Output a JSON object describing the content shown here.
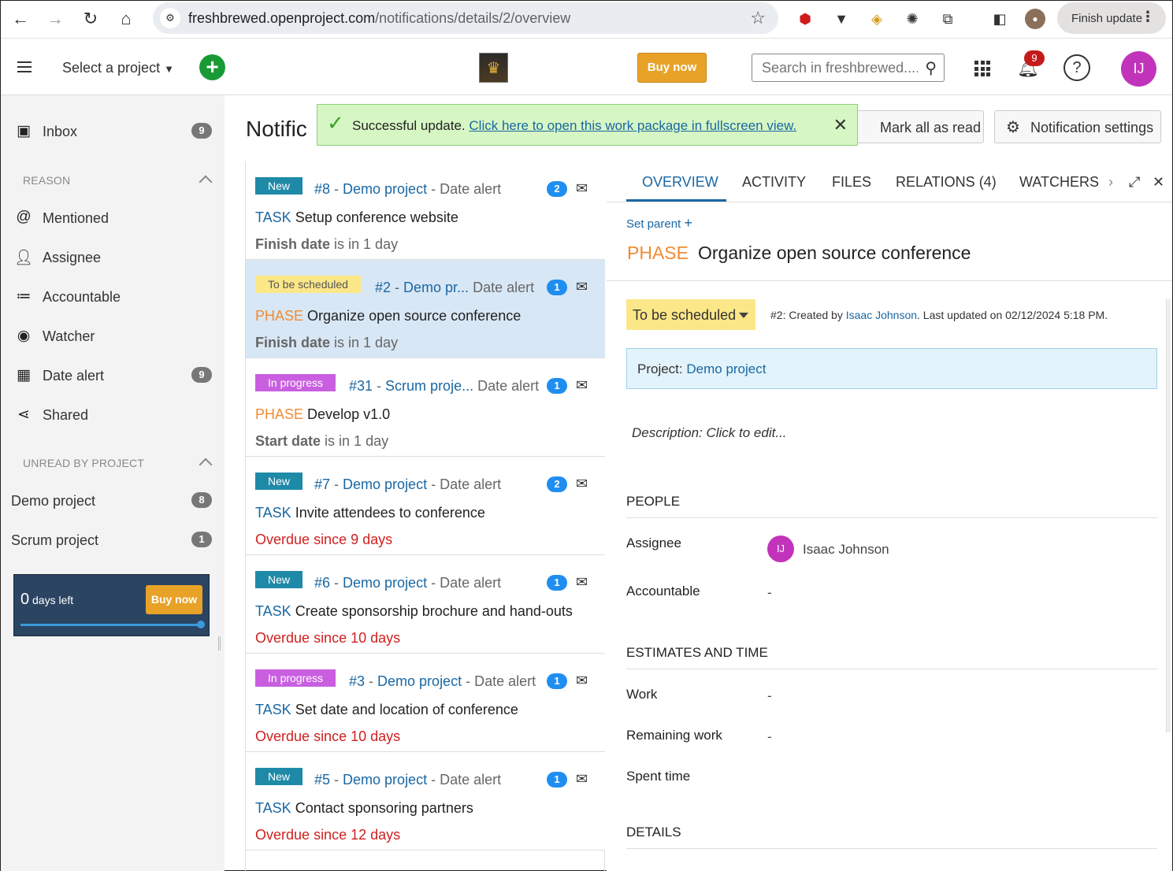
{
  "browser": {
    "url_domain": "freshbrewed.openproject.com",
    "url_path": "/notifications/details/2/overview",
    "finish_update_label": "Finish update"
  },
  "header": {
    "select_project_label": "Select a project",
    "buy_now_label": "Buy now",
    "search_placeholder": "Search in freshbrewed....",
    "notification_count": "9",
    "avatar_initials": "IJ"
  },
  "sidebar": {
    "inbox": {
      "label": "Inbox",
      "count": "9"
    },
    "reason_header": "REASON",
    "reasons": [
      {
        "label": "Mentioned",
        "icon": "at-icon"
      },
      {
        "label": "Assignee",
        "icon": "assignee-icon"
      },
      {
        "label": "Accountable",
        "icon": "accountable-icon"
      },
      {
        "label": "Watcher",
        "icon": "eye-icon"
      },
      {
        "label": "Date alert",
        "icon": "calendar-icon",
        "count": "9"
      },
      {
        "label": "Shared",
        "icon": "share-icon"
      }
    ],
    "unread_header": "UNREAD BY PROJECT",
    "projects": [
      {
        "label": "Demo project",
        "count": "8"
      },
      {
        "label": "Scrum project",
        "count": "1"
      }
    ],
    "trial": {
      "days_number": "0",
      "days_text": "days left",
      "buy_now_label": "Buy now"
    }
  },
  "page": {
    "title": "Notific",
    "toast": {
      "message": "Successful update.",
      "link_text": "Click here to open this work package in fullscreen view."
    },
    "mark_all_read_label": "Mark all as read",
    "notification_settings_label": "Notification settings"
  },
  "notifications": [
    {
      "status": "New",
      "id": "#8",
      "project": "Demo project",
      "reason": "Date alert",
      "count": "2",
      "type": "TASK",
      "subject": "Setup conference website",
      "field": "Finish date",
      "when": "is in 1 day"
    },
    {
      "status": "To be scheduled",
      "id": "#2",
      "project": "Demo pr...",
      "reason": "Date alert",
      "count": "1",
      "type": "PHASE",
      "subject": "Organize open source conference",
      "field": "Finish date",
      "when": "is in 1 day"
    },
    {
      "status": "In progress",
      "id": "#31",
      "project": "Scrum proje...",
      "reason": "Date alert",
      "count": "1",
      "type": "PHASE",
      "subject": "Develop v1.0",
      "field": "Start date",
      "when": "is in 1 day"
    },
    {
      "status": "New",
      "id": "#7",
      "project": "Demo project",
      "reason": "Date alert",
      "count": "2",
      "type": "TASK",
      "subject": "Invite attendees to conference",
      "field": "Overdue",
      "when": "since 9 days"
    },
    {
      "status": "New",
      "id": "#6",
      "project": "Demo project",
      "reason": "Date alert",
      "count": "1",
      "type": "TASK",
      "subject": "Create sponsorship brochure and hand-outs",
      "field": "Overdue",
      "when": "since 10 days"
    },
    {
      "status": "In progress",
      "id": "#3",
      "project": "Demo project",
      "reason": "Date alert",
      "count": "1",
      "type": "TASK",
      "subject": "Set date and location of conference",
      "field": "Overdue",
      "when": "since 10 days"
    },
    {
      "status": "New",
      "id": "#5",
      "project": "Demo project",
      "reason": "Date alert",
      "count": "1",
      "type": "TASK",
      "subject": "Contact sponsoring partners",
      "field": "Overdue",
      "when": "since 12 days"
    }
  ],
  "detail": {
    "tabs": [
      "OVERVIEW",
      "ACTIVITY",
      "FILES",
      "RELATIONS (4)",
      "WATCHERS"
    ],
    "set_parent_label": "Set parent",
    "type": "PHASE",
    "subject": "Organize open source conference",
    "status": "To be scheduled",
    "meta_prefix": "#2: Created by",
    "meta_author": "Isaac Johnson",
    "meta_suffix": ". Last updated on 02/12/2024 5:18 PM.",
    "project_label": "Project:",
    "project_value": "Demo project",
    "description": "Description: Click to edit...",
    "people_header": "PEOPLE",
    "assignee_label": "Assignee",
    "assignee_initials": "IJ",
    "assignee_name": "Isaac Johnson",
    "accountable_label": "Accountable",
    "accountable_value": "-",
    "estimates_header": "ESTIMATES AND TIME",
    "work_label": "Work",
    "work_value": "-",
    "remaining_label": "Remaining work",
    "remaining_value": "-",
    "spent_label": "Spent time",
    "details_header": "DETAILS"
  }
}
